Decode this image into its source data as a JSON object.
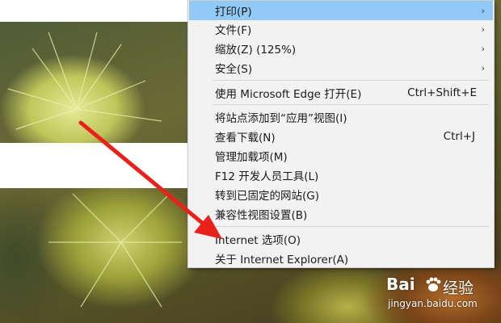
{
  "menu": {
    "items": [
      {
        "label": "打印(P)",
        "has_submenu": true,
        "highlighted": true
      },
      {
        "label": "文件(F)",
        "has_submenu": true
      },
      {
        "label": "缩放(Z) (125%)",
        "has_submenu": true
      },
      {
        "label": "安全(S)",
        "has_submenu": true
      },
      {
        "label": "使用 Microsoft Edge 打开(E)",
        "shortcut": "Ctrl+Shift+E"
      },
      {
        "label": "将站点添加到“应用”视图(I)"
      },
      {
        "label": "查看下载(N)",
        "shortcut": "Ctrl+J"
      },
      {
        "label": "管理加载项(M)"
      },
      {
        "label": "F12 开发人员工具(L)"
      },
      {
        "label": "转到已固定的网站(G)"
      },
      {
        "label": "兼容性视图设置(B)"
      },
      {
        "label": "Internet 选项(O)"
      },
      {
        "label": "关于 Internet Explorer(A)"
      }
    ],
    "submenu_arrow": "›"
  },
  "annotation": {
    "arrow_color": "#e8221b"
  },
  "watermark": {
    "logo": "Bai",
    "logo_cn": "经验",
    "url": "jingyan.baidu.com"
  },
  "colors": {
    "highlight": "#91c9f7",
    "menu_bg": "#f2f2f2"
  }
}
